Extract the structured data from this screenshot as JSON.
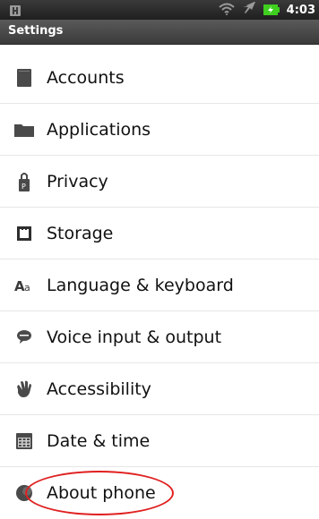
{
  "status_bar": {
    "time": "4:03",
    "icons": [
      "usb-icon",
      "wifi-icon",
      "airplane-icon",
      "battery-icon"
    ],
    "battery_color": "#3ecf1f"
  },
  "title_bar": {
    "title": "Settings"
  },
  "settings": {
    "items": [
      {
        "label": "Accounts",
        "icon": "accounts-icon"
      },
      {
        "label": "Applications",
        "icon": "folder-icon"
      },
      {
        "label": "Privacy",
        "icon": "lock-icon"
      },
      {
        "label": "Storage",
        "icon": "sd-card-icon"
      },
      {
        "label": "Language & keyboard",
        "icon": "language-icon"
      },
      {
        "label": "Voice input & output",
        "icon": "speech-bubble-icon"
      },
      {
        "label": "Accessibility",
        "icon": "hand-icon"
      },
      {
        "label": "Date & time",
        "icon": "calendar-icon"
      },
      {
        "label": "About phone",
        "icon": "info-icon"
      }
    ]
  },
  "annotation": {
    "color": "#e02020",
    "shape": "ellipse"
  }
}
